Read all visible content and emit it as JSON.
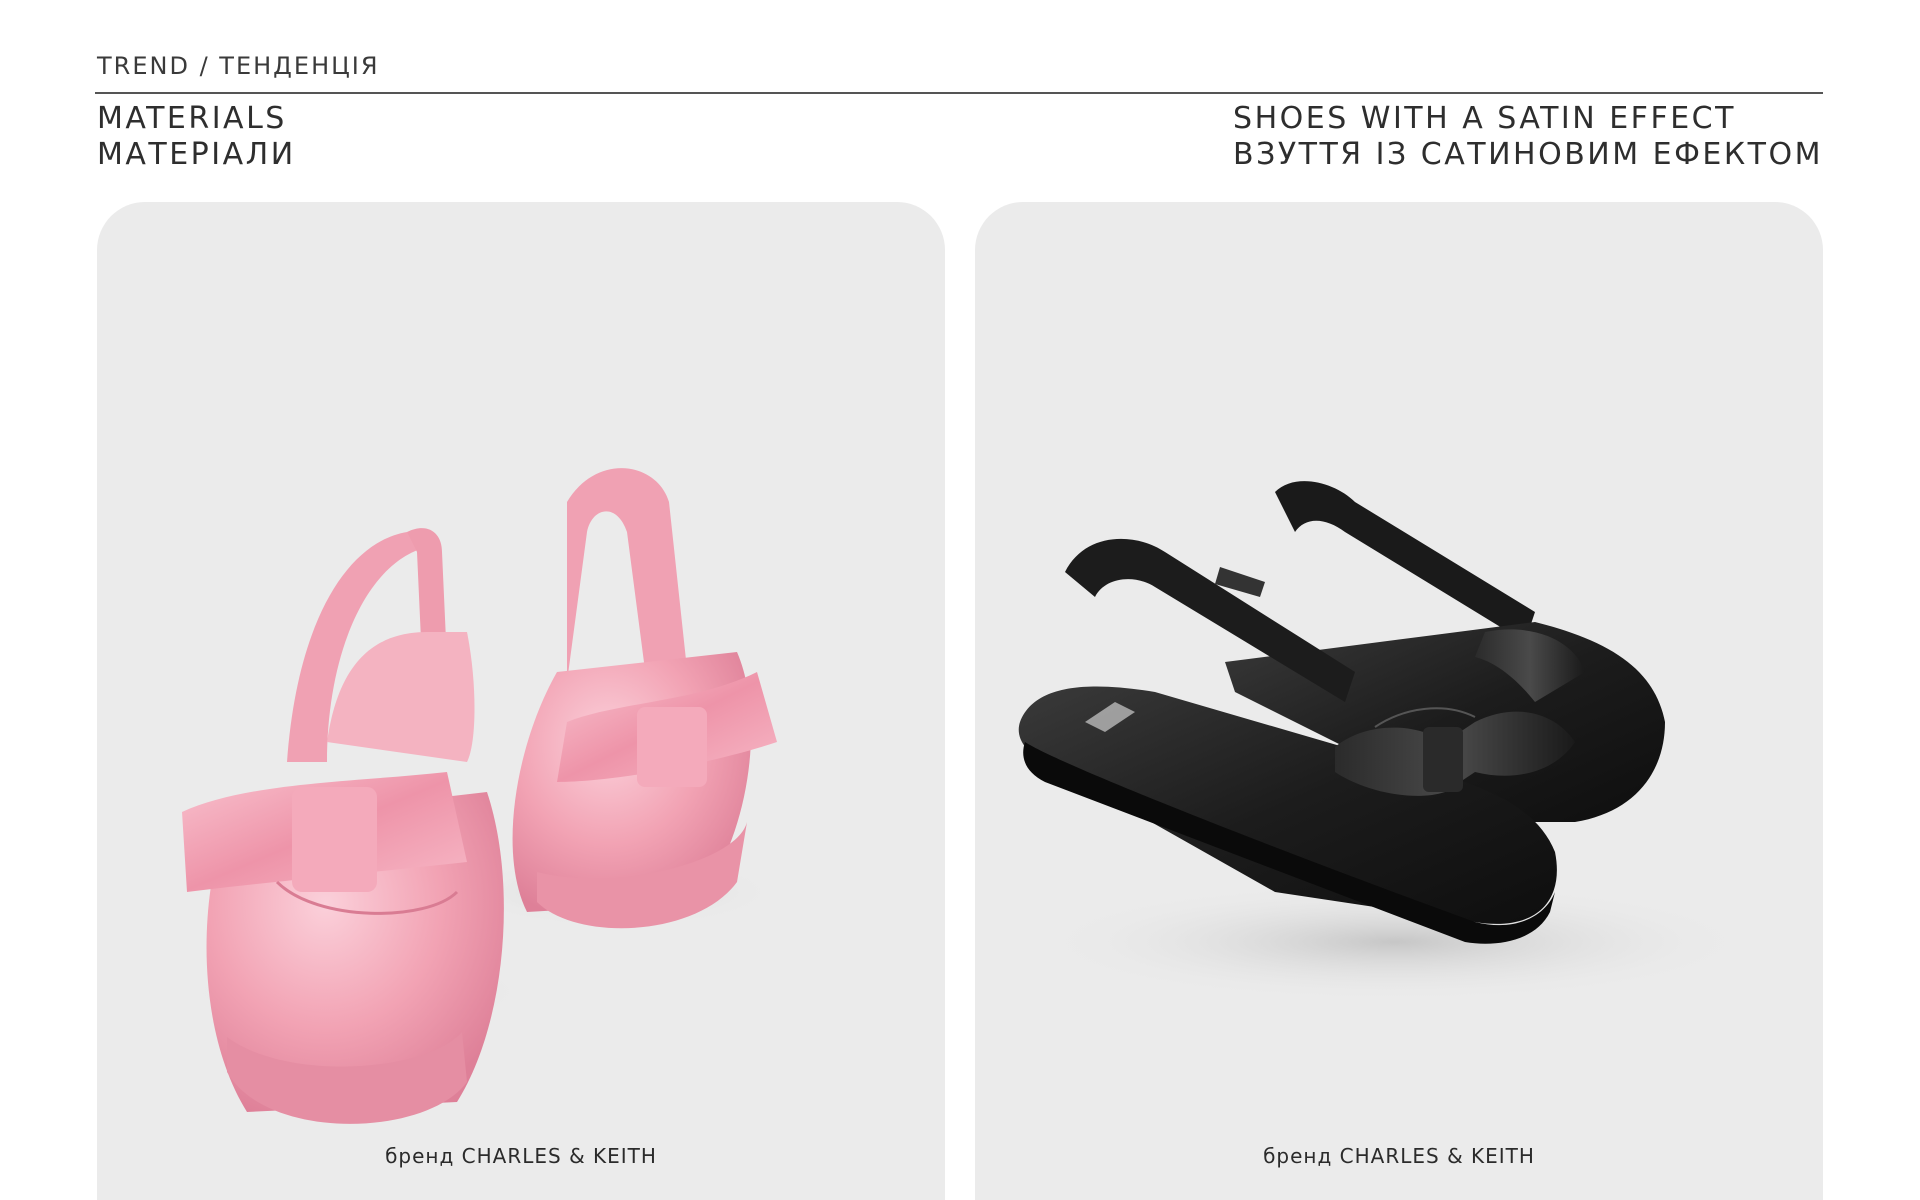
{
  "header": {
    "eyebrow": "TREND / ТЕНДЕНЦІЯ",
    "left_title_en": "MATERIALS",
    "left_title_ua": "МАТЕРІАЛИ",
    "right_title_en": "SHOES WITH A SATIN EFFECT",
    "right_title_ua": "ВЗУТТЯ ІЗ САТИНОВИМ ЕФЕКТОМ"
  },
  "cards": [
    {
      "image": "pink-satin-bow-slingback-flats",
      "caption": "бренд CHARLES & KEITH",
      "shoe_color": "#f2a3b4",
      "shoe_highlight": "#f9c4cf",
      "shoe_shadow": "#e07f97"
    },
    {
      "image": "black-satin-bow-slingback-flats",
      "caption": "бренд CHARLES & KEITH",
      "shoe_color": "#1e1e1e",
      "shoe_highlight": "#3a3a3a",
      "shoe_shadow": "#0c0c0c"
    }
  ],
  "colors": {
    "card_background": "#ebebeb",
    "rule": "#555555",
    "text": "#2b2b2b"
  }
}
